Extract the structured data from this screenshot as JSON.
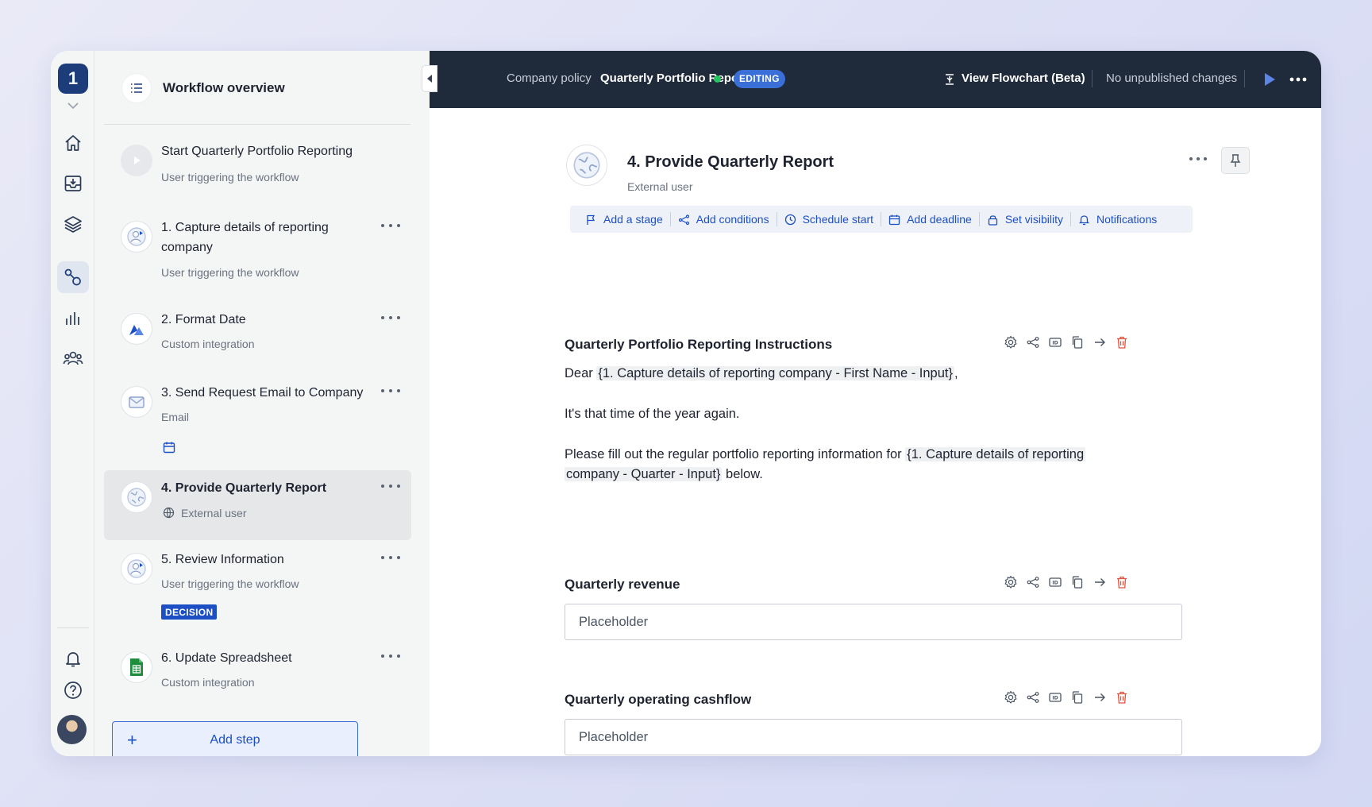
{
  "rail": {
    "org_badge": "1"
  },
  "sidebar": {
    "overview_title": "Workflow overview",
    "steps": [
      {
        "title": "Start Quarterly Portfolio Reporting",
        "subtitle": "User triggering the workflow"
      },
      {
        "title": "1. Capture details of reporting company",
        "subtitle": "User triggering the workflow"
      },
      {
        "title": "2. Format Date",
        "subtitle": "Custom integration"
      },
      {
        "title": "3. Send Request Email to Company",
        "subtitle": "Email"
      },
      {
        "title": "4. Provide Quarterly Report",
        "subtitle": "External user"
      },
      {
        "title": "5. Review Information",
        "subtitle": "User triggering the workflow",
        "badge": "DECISION"
      },
      {
        "title": "6. Update Spreadsheet",
        "subtitle": "Custom integration"
      }
    ],
    "add_step_label": "Add step"
  },
  "topbar": {
    "breadcrumb_parent": "Company policy",
    "breadcrumb_current": "Quarterly Portfolio Reporting",
    "status_badge": "EDITING",
    "view_flowchart": "View Flowchart (Beta)",
    "publish_status": "No unpublished changes"
  },
  "main": {
    "title": "4. Provide Quarterly Report",
    "subtitle": "External user",
    "actions": [
      "Add a stage",
      "Add conditions",
      "Schedule start",
      "Add deadline",
      "Set visibility",
      "Notifications"
    ],
    "instructions": {
      "label": "Quarterly Portfolio Reporting Instructions",
      "dear": "Dear",
      "var_first_name": "{1. Capture details of reporting company - First Name - Input}",
      "comma": ",",
      "line2": "It's that time of the year again.",
      "line3_prefix": "Please fill out the regular portfolio reporting information for",
      "var_quarter_a": "{1. Capture details of reporting",
      "var_quarter_b": "company - Quarter - Input}",
      "line3_suffix": "below."
    },
    "fields": [
      {
        "label": "Quarterly revenue",
        "placeholder": "Placeholder"
      },
      {
        "label": "Quarterly operating cashflow",
        "placeholder": "Placeholder"
      }
    ]
  },
  "colors": {
    "brand_navy": "#1c3d7a",
    "topbar": "#1f2a3a",
    "accent_blue": "#1c4fc4",
    "live_green": "#22c55e",
    "delete_red": "#e0533f"
  }
}
